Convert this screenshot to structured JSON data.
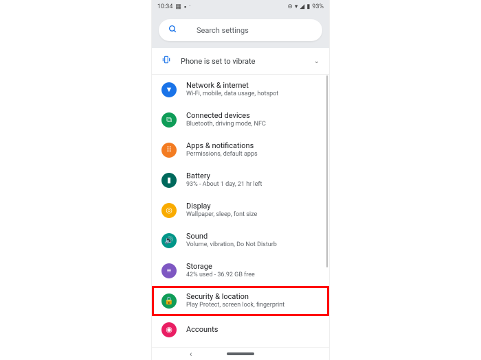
{
  "status": {
    "time": "10:34",
    "battery": "93%"
  },
  "search": {
    "placeholder": "Search settings"
  },
  "banner": {
    "text": "Phone is set to vibrate"
  },
  "items": [
    {
      "title": "Network & internet",
      "sub": "Wi-Fi, mobile, data usage, hotspot",
      "color": "#1a73e8",
      "glyph": "▼",
      "name": "network-internet"
    },
    {
      "title": "Connected devices",
      "sub": "Bluetooth, driving mode, NFC",
      "color": "#0f9d58",
      "glyph": "⧉",
      "name": "connected-devices"
    },
    {
      "title": "Apps & notifications",
      "sub": "Permissions, default apps",
      "color": "#f37c22",
      "glyph": "⠿",
      "name": "apps-notifications"
    },
    {
      "title": "Battery",
      "sub": "93% - About 1 day, 21 hr left",
      "color": "#00695c",
      "glyph": "▮",
      "name": "battery"
    },
    {
      "title": "Display",
      "sub": "Wallpaper, sleep, font size",
      "color": "#f9ab00",
      "glyph": "◎",
      "name": "display"
    },
    {
      "title": "Sound",
      "sub": "Volume, vibration, Do Not Disturb",
      "color": "#009688",
      "glyph": "🔊",
      "name": "sound"
    },
    {
      "title": "Storage",
      "sub": "42% used - 36.92 GB free",
      "color": "#7e57c2",
      "glyph": "≡",
      "name": "storage"
    },
    {
      "title": "Security & location",
      "sub": "Play Protect, screen lock, fingerprint",
      "color": "#0f9d58",
      "glyph": "🔒",
      "name": "security-location",
      "highlight": true
    },
    {
      "title": "Accounts",
      "sub": "",
      "color": "#e91e63",
      "glyph": "◉",
      "name": "accounts"
    }
  ]
}
